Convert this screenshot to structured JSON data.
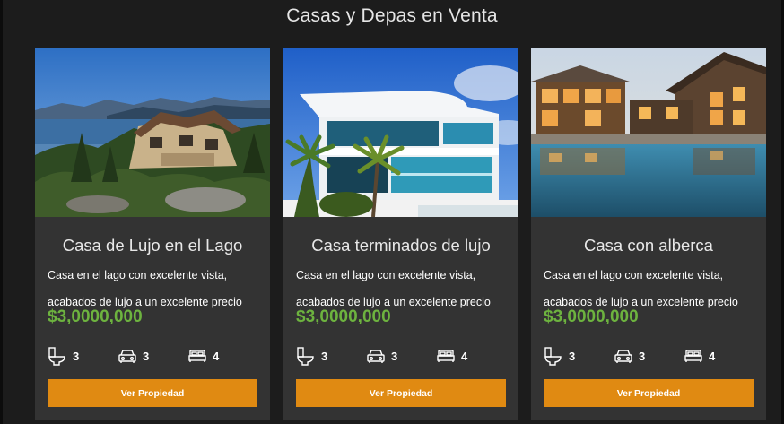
{
  "section": {
    "title": "Casas y Depas en Venta"
  },
  "colors": {
    "background": "#1c1c1c",
    "card": "#333333",
    "price": "#6db33f",
    "button": "#e08a12"
  },
  "listings": [
    {
      "title": "Casa de Lujo en el Lago",
      "description_line1": "Casa en el lago con excelente vista,",
      "description_line2": "acabados de lujo a un excelente precio",
      "price": "$3,0000,000",
      "baths": "3",
      "parking": "3",
      "beds": "4",
      "button_label": "Ver Propiedad",
      "image": "lake-house-photo"
    },
    {
      "title": "Casa terminados de lujo",
      "description_line1": "Casa en el lago con excelente vista,",
      "description_line2": "acabados de lujo a un excelente precio",
      "price": "$3,0000,000",
      "baths": "3",
      "parking": "3",
      "beds": "4",
      "button_label": "Ver Propiedad",
      "image": "modern-house-photo"
    },
    {
      "title": "Casa con alberca",
      "description_line1": "Casa en el lago con excelente vista,",
      "description_line2": "acabados de lujo a un excelente precio",
      "price": "$3,0000,000",
      "baths": "3",
      "parking": "3",
      "beds": "4",
      "button_label": "Ver Propiedad",
      "image": "pool-house-photo"
    }
  ],
  "icons": {
    "baths": "toilet-icon",
    "parking": "car-icon",
    "beds": "bed-icon"
  }
}
